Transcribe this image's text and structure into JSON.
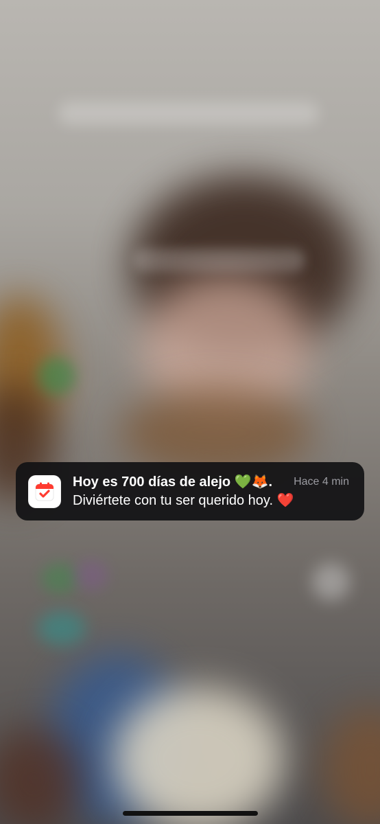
{
  "lock_screen": {
    "wallpaper": "blurred photo of a person",
    "dimmed_time": ""
  },
  "notification": {
    "app_icon": "calendar-check-icon",
    "title": "Hoy es 700 días de alejo 💚🦊.",
    "body": "Diviértete con tu ser querido hoy. ❤️",
    "time": "Hace 4 min",
    "accent_color": "#ff3b30",
    "background_color": "#121214"
  },
  "system": {
    "home_indicator": "home-indicator"
  }
}
